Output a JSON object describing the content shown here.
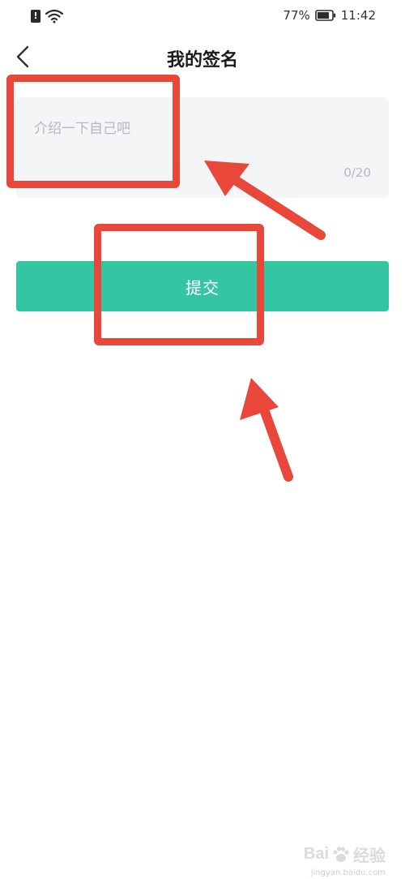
{
  "status_bar": {
    "battery_percent": "77%",
    "time": "11:42",
    "notification_glyph": "!",
    "icons": [
      "notification-icon",
      "wifi-icon",
      "battery-icon"
    ]
  },
  "header": {
    "title": "我的签名",
    "back_icon": "chevron-left-icon"
  },
  "signature": {
    "placeholder": "介绍一下自己吧",
    "value": "",
    "counter": "0/20"
  },
  "submit": {
    "label": "提交"
  },
  "watermark": {
    "brand_a": "Bai",
    "brand_b": "经验",
    "domain": "jingyan.baidu.com"
  },
  "colors": {
    "accent": "#34c6a3",
    "annotation": "#e8473a",
    "input_bg": "#f4f5f7",
    "placeholder": "#b5b8c0"
  }
}
